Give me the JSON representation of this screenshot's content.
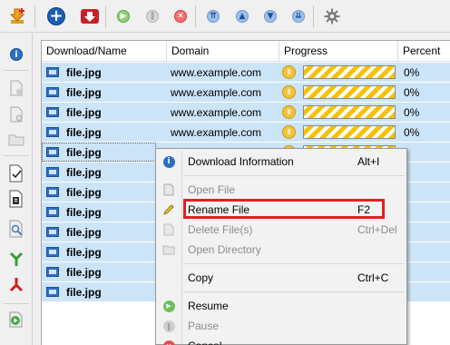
{
  "toolbar": {
    "buttons": [
      {
        "name": "download-arrow-icon"
      },
      {
        "name": "add-download-icon"
      },
      {
        "name": "delete-download-icon"
      },
      {
        "name": "resume-icon"
      },
      {
        "name": "pause-icon"
      },
      {
        "name": "stop-icon"
      },
      {
        "name": "move-top-icon"
      },
      {
        "name": "move-up-icon"
      },
      {
        "name": "move-down-icon"
      },
      {
        "name": "move-bottom-icon"
      },
      {
        "name": "settings-icon"
      }
    ]
  },
  "columns": [
    "Download/Name",
    "Domain",
    "Progress",
    "Percent"
  ],
  "rows": [
    {
      "name": "file.jpg",
      "domain": "www.example.com",
      "percent": "0%"
    },
    {
      "name": "file.jpg",
      "domain": "www.example.com",
      "percent": "0%"
    },
    {
      "name": "file.jpg",
      "domain": "www.example.com",
      "percent": "0%"
    },
    {
      "name": "file.jpg",
      "domain": "www.example.com",
      "percent": "0%"
    },
    {
      "name": "file.jpg",
      "domain": "",
      "percent": ""
    },
    {
      "name": "file.jpg",
      "domain": "",
      "percent": ""
    },
    {
      "name": "file.jpg",
      "domain": "",
      "percent": ""
    },
    {
      "name": "file.jpg",
      "domain": "",
      "percent": ""
    },
    {
      "name": "file.jpg",
      "domain": "",
      "percent": ""
    },
    {
      "name": "file.jpg",
      "domain": "",
      "percent": ""
    },
    {
      "name": "file.jpg",
      "domain": "",
      "percent": ""
    },
    {
      "name": "file.jpg",
      "domain": "",
      "percent": ""
    }
  ],
  "progress_fraction": 0.0,
  "context_menu": {
    "download_info": {
      "label": "Download Information",
      "shortcut": "Alt+I"
    },
    "open_file": {
      "label": "Open File",
      "shortcut": ""
    },
    "rename_file": {
      "label": "Rename File",
      "shortcut": "F2"
    },
    "delete_files": {
      "label": "Delete File(s)",
      "shortcut": "Ctrl+Del"
    },
    "open_directory": {
      "label": "Open Directory",
      "shortcut": ""
    },
    "copy": {
      "label": "Copy",
      "shortcut": "Ctrl+C"
    },
    "resume": {
      "label": "Resume",
      "shortcut": ""
    },
    "pause": {
      "label": "Pause",
      "shortcut": ""
    },
    "cancel": {
      "label": "Cancel",
      "shortcut": ""
    }
  },
  "colors": {
    "selection": "#cce4f7",
    "progress_stripe": "#f6c200",
    "highlight_box": "#e02020"
  }
}
